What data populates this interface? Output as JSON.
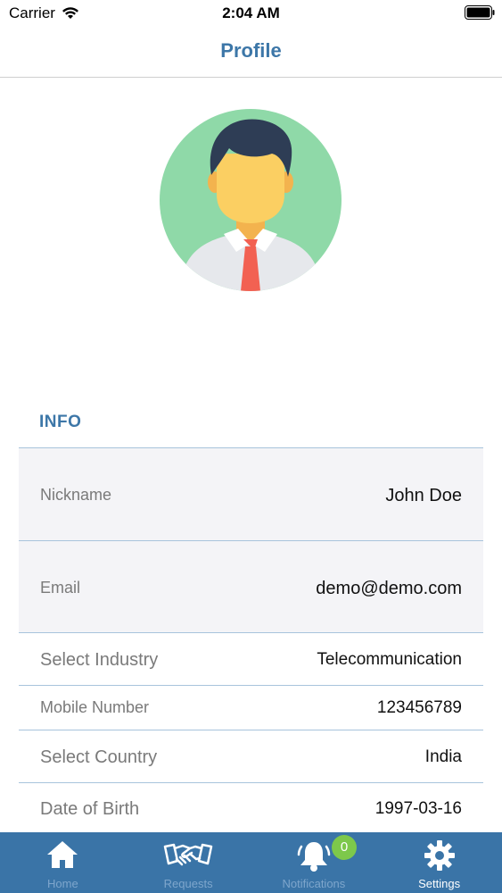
{
  "status_bar": {
    "carrier": "Carrier",
    "time": "2:04 AM"
  },
  "nav": {
    "title": "Profile"
  },
  "info": {
    "header": "INFO",
    "rows": [
      {
        "label": "Nickname",
        "value": "John Doe"
      },
      {
        "label": "Email",
        "value": "demo@demo.com"
      },
      {
        "label": "Select Industry",
        "value": "Telecommunication"
      },
      {
        "label": "Mobile Number",
        "value": "123456789"
      },
      {
        "label": "Select Country",
        "value": "India"
      },
      {
        "label": "Date of Birth",
        "value": "1997-03-16"
      }
    ]
  },
  "tab_bar": {
    "tabs": [
      {
        "label": "Home",
        "icon": "home-icon"
      },
      {
        "label": "Requests",
        "icon": "handshake-icon"
      },
      {
        "label": "Notifications",
        "icon": "bell-icon"
      },
      {
        "label": "Settings",
        "icon": "gear-icon"
      }
    ],
    "notification_badge": "0",
    "active_tab": "Settings"
  },
  "colors": {
    "accent": "#3d77a8",
    "tab_bar_bg": "#3a74a7",
    "badge": "#7dc84b",
    "avatar_bg": "#8fd9a8"
  }
}
